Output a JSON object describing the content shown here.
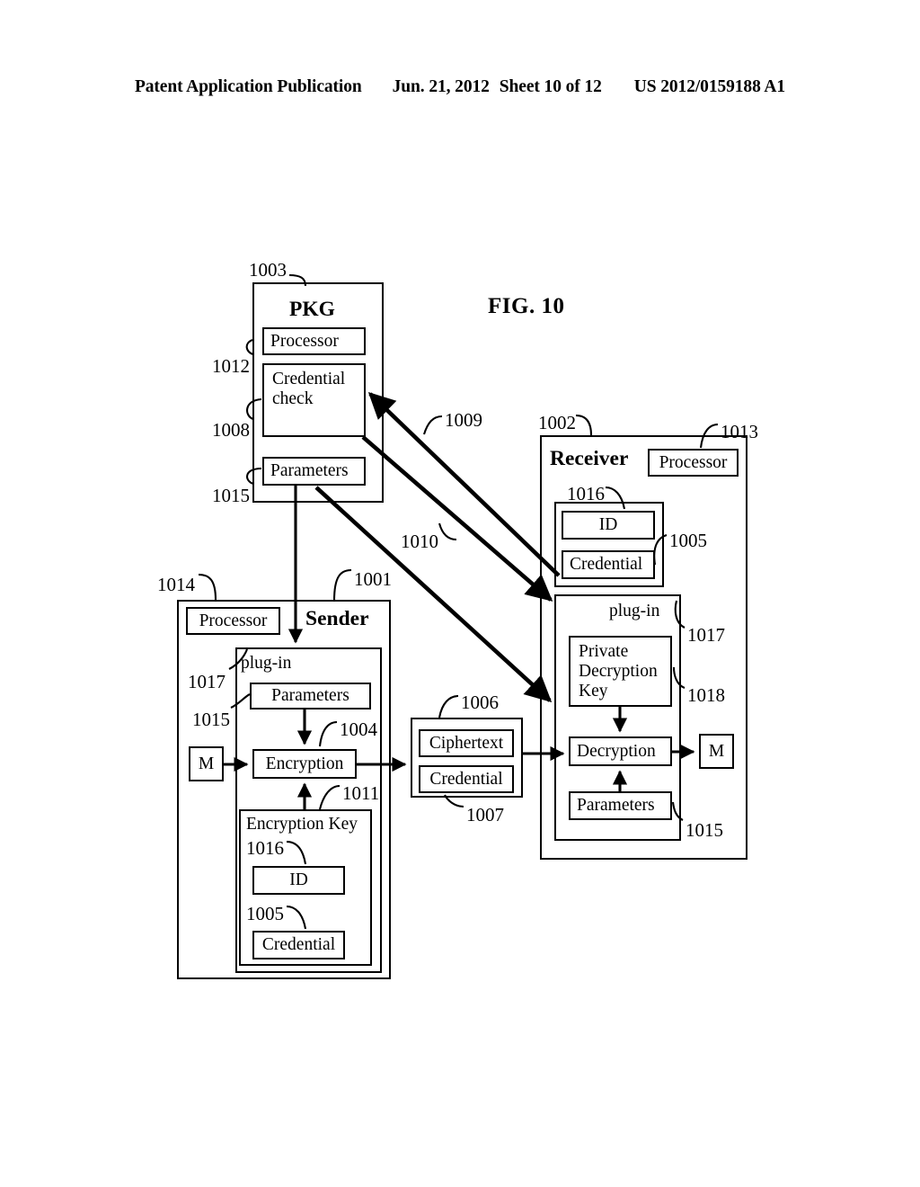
{
  "header": {
    "publication": "Patent Application Publication",
    "date": "Jun. 21, 2012",
    "sheet": "Sheet 10 of 12",
    "number": "US 2012/0159188 A1"
  },
  "figure": {
    "label": "FIG. 10"
  },
  "pkg": {
    "ref": "1003",
    "title": "PKG",
    "processor": {
      "label": "Processor",
      "ref": "1012"
    },
    "credential_check": {
      "label": "Credential check",
      "line1": "Credential",
      "line2": "check",
      "ref": "1008"
    },
    "parameters": {
      "label": "Parameters",
      "ref": "1015"
    }
  },
  "sender": {
    "ref": "1001",
    "title": "Sender",
    "processor": {
      "label": "Processor",
      "ref": "1014"
    },
    "plugin": {
      "label": "plug-in",
      "ref": "1017"
    },
    "parameters": {
      "label": "Parameters",
      "ref": "1015"
    },
    "message_in": {
      "label": "M"
    },
    "encryption": {
      "label": "Encryption",
      "ref": "1004"
    },
    "encryption_key": {
      "label": "Encryption Key",
      "ref": "1011",
      "id": {
        "label": "ID",
        "ref": "1016"
      },
      "credential": {
        "label": "Credential",
        "ref": "1005"
      }
    }
  },
  "transmission": {
    "ciphertext": {
      "label": "Ciphertext",
      "ref": "1006"
    },
    "credential": {
      "label": "Credential",
      "ref": "1007"
    }
  },
  "receiver": {
    "ref": "1002",
    "title": "Receiver",
    "processor": {
      "label": "Processor",
      "ref": "1013"
    },
    "identity": {
      "ref": "1016",
      "id": {
        "label": "ID"
      },
      "credential": {
        "label": "Credential",
        "ref": "1005"
      }
    },
    "plugin": {
      "label": "plug-in",
      "ref": "1017"
    },
    "private_decryption_key": {
      "label": "Private Decryption Key",
      "line1": "Private",
      "line2": "Decryption",
      "line3": "Key",
      "ref": "1018"
    },
    "decryption": {
      "label": "Decryption"
    },
    "parameters": {
      "label": "Parameters",
      "ref": "1015"
    },
    "message_out": {
      "label": "M"
    }
  },
  "connectors": {
    "credential_request": {
      "ref": "1009"
    },
    "key_delivery": {
      "ref": "1010"
    }
  },
  "colors": {
    "ink": "#000000",
    "paper": "#ffffff"
  }
}
